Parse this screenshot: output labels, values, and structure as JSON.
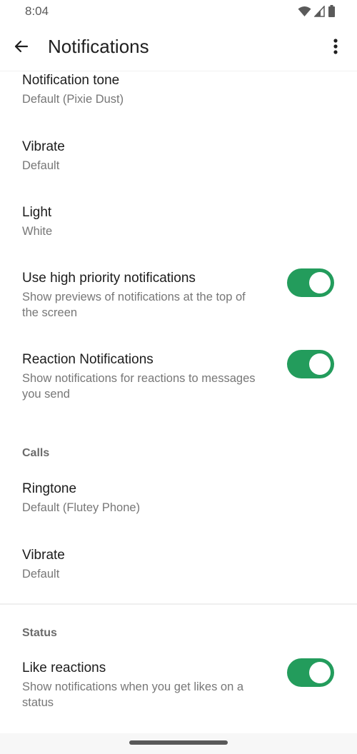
{
  "status_bar": {
    "time": "8:04",
    "icons": [
      "wifi-icon",
      "cellular-signal-icon",
      "battery-icon"
    ]
  },
  "app_bar": {
    "title": "Notifications",
    "back_icon": "arrow-left-icon",
    "more_icon": "more-vert-icon"
  },
  "messages": {
    "items": [
      {
        "title": "Notification tone",
        "subtitle": "Default (Pixie Dust)"
      },
      {
        "title": "Vibrate",
        "subtitle": "Default"
      },
      {
        "title": "Light",
        "subtitle": "White"
      },
      {
        "title": "Use high priority notifications",
        "subtitle": "Show previews of notifications at the top of the screen",
        "toggle": true
      },
      {
        "title": "Reaction Notifications",
        "subtitle": "Show notifications for reactions to messages you send",
        "toggle": true
      }
    ]
  },
  "calls": {
    "header": "Calls",
    "items": [
      {
        "title": "Ringtone",
        "subtitle": "Default (Flutey Phone)"
      },
      {
        "title": "Vibrate",
        "subtitle": "Default"
      }
    ]
  },
  "status": {
    "header": "Status",
    "items": [
      {
        "title": "Like reactions",
        "subtitle": "Show notifications when you get likes on a status",
        "toggle": true
      }
    ]
  },
  "colors": {
    "toggle_on": "#239c5c",
    "title_text": "#1c1c1c",
    "subtitle_text": "#777777"
  }
}
